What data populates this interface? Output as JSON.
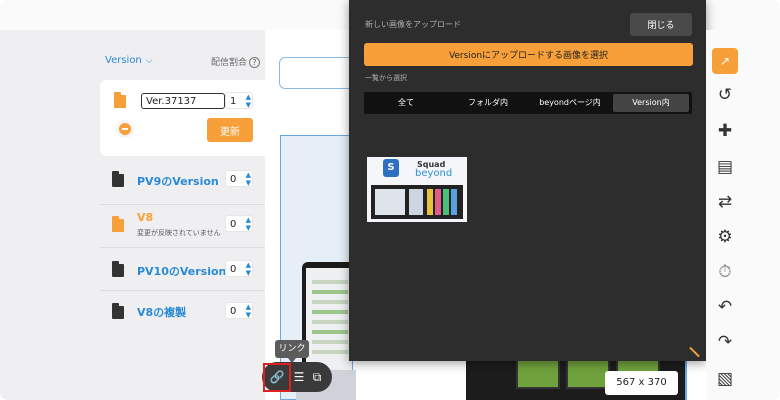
{
  "version_panel": {
    "header_label": "Version",
    "dropdown_icon": "chevron-down-icon",
    "ratio_label": "配信割合",
    "help_icon": "help-circle-icon",
    "current_version_value": "Ver.37137",
    "current_ratio_value": "1",
    "update_label": "更新",
    "versions": [
      {
        "name": "PV9のVersion",
        "ratio": "0",
        "note": ""
      },
      {
        "name": "V8",
        "ratio": "0",
        "note": "変更が反映されていません"
      },
      {
        "name": "PV10のVersion",
        "ratio": "0",
        "note": ""
      },
      {
        "name": "V8の複製",
        "ratio": "0",
        "note": ""
      }
    ]
  },
  "image_modal": {
    "title": "新しい画像をアップロード",
    "close_label": "閉じる",
    "upload_label": "Versionにアップロードする画像を選択",
    "pick_label": "一覧から選択",
    "tabs": [
      {
        "label": "全て",
        "active": false
      },
      {
        "label": "フォルダ内",
        "active": false
      },
      {
        "label": "beyondページ内",
        "active": false
      },
      {
        "label": "Version内",
        "active": true
      }
    ],
    "thumbnail": {
      "logo_letter": "S",
      "line1": "Squad",
      "line2": "beyond"
    }
  },
  "mini_toolbar": {
    "tooltip": "リンク",
    "buttons": [
      "link-icon",
      "align-left-icon",
      "copy-icon"
    ]
  },
  "canvas": {
    "size_label": "567 x 370"
  },
  "right_toolbar": {
    "icons": [
      "external-link-icon",
      "history-icon",
      "puzzle-icon",
      "edit-list-icon",
      "swap-icon",
      "file-settings-icon",
      "stopwatch-icon",
      "undo-icon",
      "redo-icon",
      "image-add-icon"
    ]
  },
  "colors": {
    "accent": "#f7a03a",
    "link_blue": "#2a8ad4",
    "modal_bg": "#2d2d2d",
    "highlight_red": "#e02020"
  }
}
